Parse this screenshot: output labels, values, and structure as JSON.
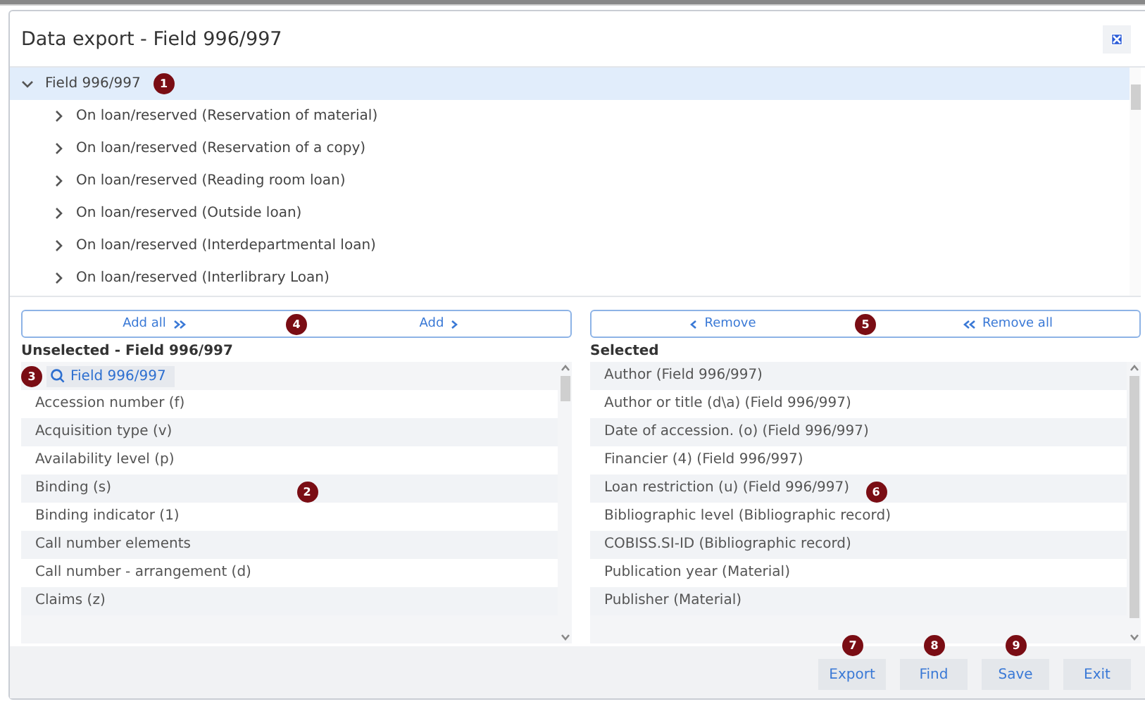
{
  "window": {
    "title": "Data export - Field 996/997"
  },
  "tree": {
    "label": "Field 996/997",
    "expanded": true,
    "selected": true,
    "badge": "1",
    "children": [
      {
        "label": "On loan/reserved (Reservation of material)",
        "expanded": false
      },
      {
        "label": "On loan/reserved (Reservation of a copy)",
        "expanded": false
      },
      {
        "label": "On loan/reserved (Reading room loan)",
        "expanded": false
      },
      {
        "label": "On loan/reserved (Outside loan)",
        "expanded": false
      },
      {
        "label": "On loan/reserved (Interdepartmental loan)",
        "expanded": false
      },
      {
        "label": "On loan/reserved (Interlibrary Loan)",
        "expanded": false
      }
    ]
  },
  "add_bar": {
    "badge": "4",
    "buttons": [
      {
        "label": "Add all",
        "kind": "all"
      },
      {
        "label": "Add",
        "kind": "one"
      }
    ]
  },
  "remove_bar": {
    "badge": "5",
    "buttons": [
      {
        "label": "Remove",
        "kind": "one"
      },
      {
        "label": "Remove all",
        "kind": "all"
      }
    ]
  },
  "unselected": {
    "heading": "Unselected - Field 996/997",
    "badge": "2",
    "filter": {
      "label": "Field 996/997",
      "badge": "3"
    },
    "items": [
      "Accession number (f)",
      "Acquisition type (v)",
      "Availability level (p)",
      "Binding (s)",
      "Binding indicator (1)",
      "Call number elements",
      "Call number - arrangement (d)",
      "Claims (z)"
    ]
  },
  "selected": {
    "heading": "Selected",
    "badge": "6",
    "items": [
      "Author (Field 996/997)",
      "Author or title (d\\a) (Field 996/997)",
      "Date of accession. (o) (Field 996/997)",
      "Financier (4) (Field 996/997)",
      "Loan restriction (u) (Field 996/997)",
      "Bibliographic level (Bibliographic record)",
      "COBISS.SI-ID (Bibliographic record)",
      "Publication year (Material)",
      "Publisher (Material)"
    ]
  },
  "footer_buttons": [
    {
      "label": "Export",
      "badge": "7"
    },
    {
      "label": "Find",
      "badge": "8"
    },
    {
      "label": "Save",
      "badge": "9"
    },
    {
      "label": "Exit"
    }
  ]
}
